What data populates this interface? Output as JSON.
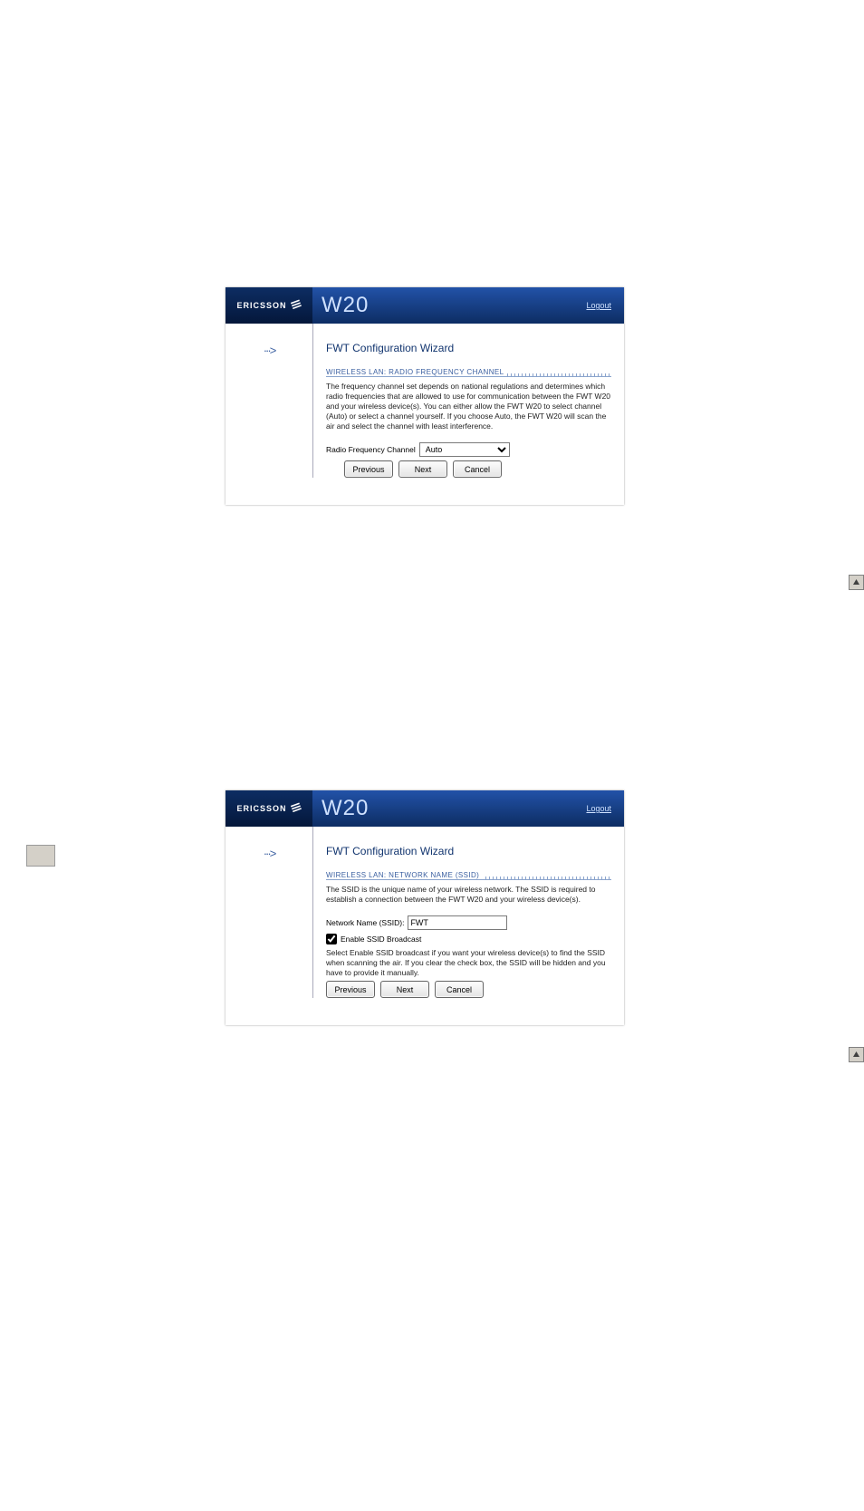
{
  "brand": "ERICSSON",
  "product": "W20",
  "logout": "Logout",
  "wizard_title": "FWT Configuration Wizard",
  "arrow_glyph": "···>",
  "buttons": {
    "previous": "Previous",
    "next": "Next",
    "cancel": "Cancel"
  },
  "panel1": {
    "section": "WIRELESS LAN: RADIO FREQUENCY CHANNEL",
    "desc": "The frequency channel set depends on national regulations and determines which radio frequencies that are allowed to use for communication between the FWT W20 and your wireless device(s). You can either allow the FWT W20 to select channel (Auto) or select a channel yourself. If you choose Auto, the FWT W20 will scan the air and select the channel with least interference.",
    "field_label": "Radio Frequency Channel",
    "field_value": "Auto"
  },
  "panel2": {
    "section": "WIRELESS LAN: NETWORK NAME (SSID)",
    "desc": "The SSID is the unique name of your wireless network. The SSID is required to establish a connection between the FWT W20 and your wireless device(s).",
    "field_label": "Network Name (SSID):",
    "field_value": "FWT",
    "checkbox_label": "Enable SSID Broadcast",
    "checkbox_checked": true,
    "note": "Select Enable SSID broadcast if you want your wireless device(s) to find the SSID when scanning the air. If you clear the check box, the SSID will be hidden and you have to provide it manually."
  }
}
